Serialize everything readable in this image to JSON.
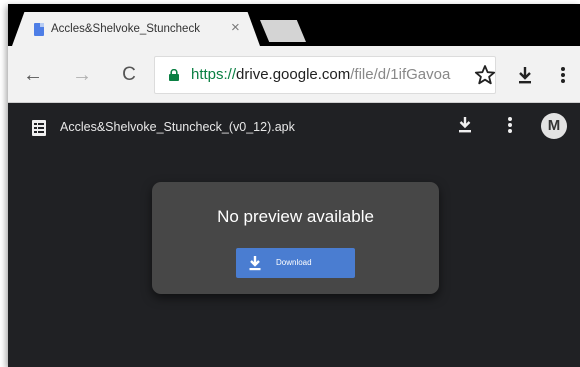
{
  "browser": {
    "tab": {
      "title": "Accles&Shelvoke_Stuncheck",
      "close_glyph": "×",
      "favicon": "drive-file-icon"
    },
    "toolbar": {
      "back_glyph": "←",
      "forward_glyph": "→",
      "reload_glyph": "C",
      "url": {
        "scheme": "https://",
        "host": "drive.google.com",
        "path": "/file/d/1ifGavoa"
      },
      "icons": [
        "lock-icon",
        "star-icon",
        "download-icon",
        "menu-icon"
      ]
    }
  },
  "drive": {
    "header": {
      "file_name": "Accles&Shelvoke_Stuncheck_(v0_12).apk",
      "avatar_initial": "M"
    },
    "preview": {
      "message": "No preview available",
      "download_label": "Download"
    }
  },
  "colors": {
    "background": "#202124",
    "card": "#474747",
    "accent_button": "#4a7dd1",
    "url_scheme": "#0b8043"
  }
}
